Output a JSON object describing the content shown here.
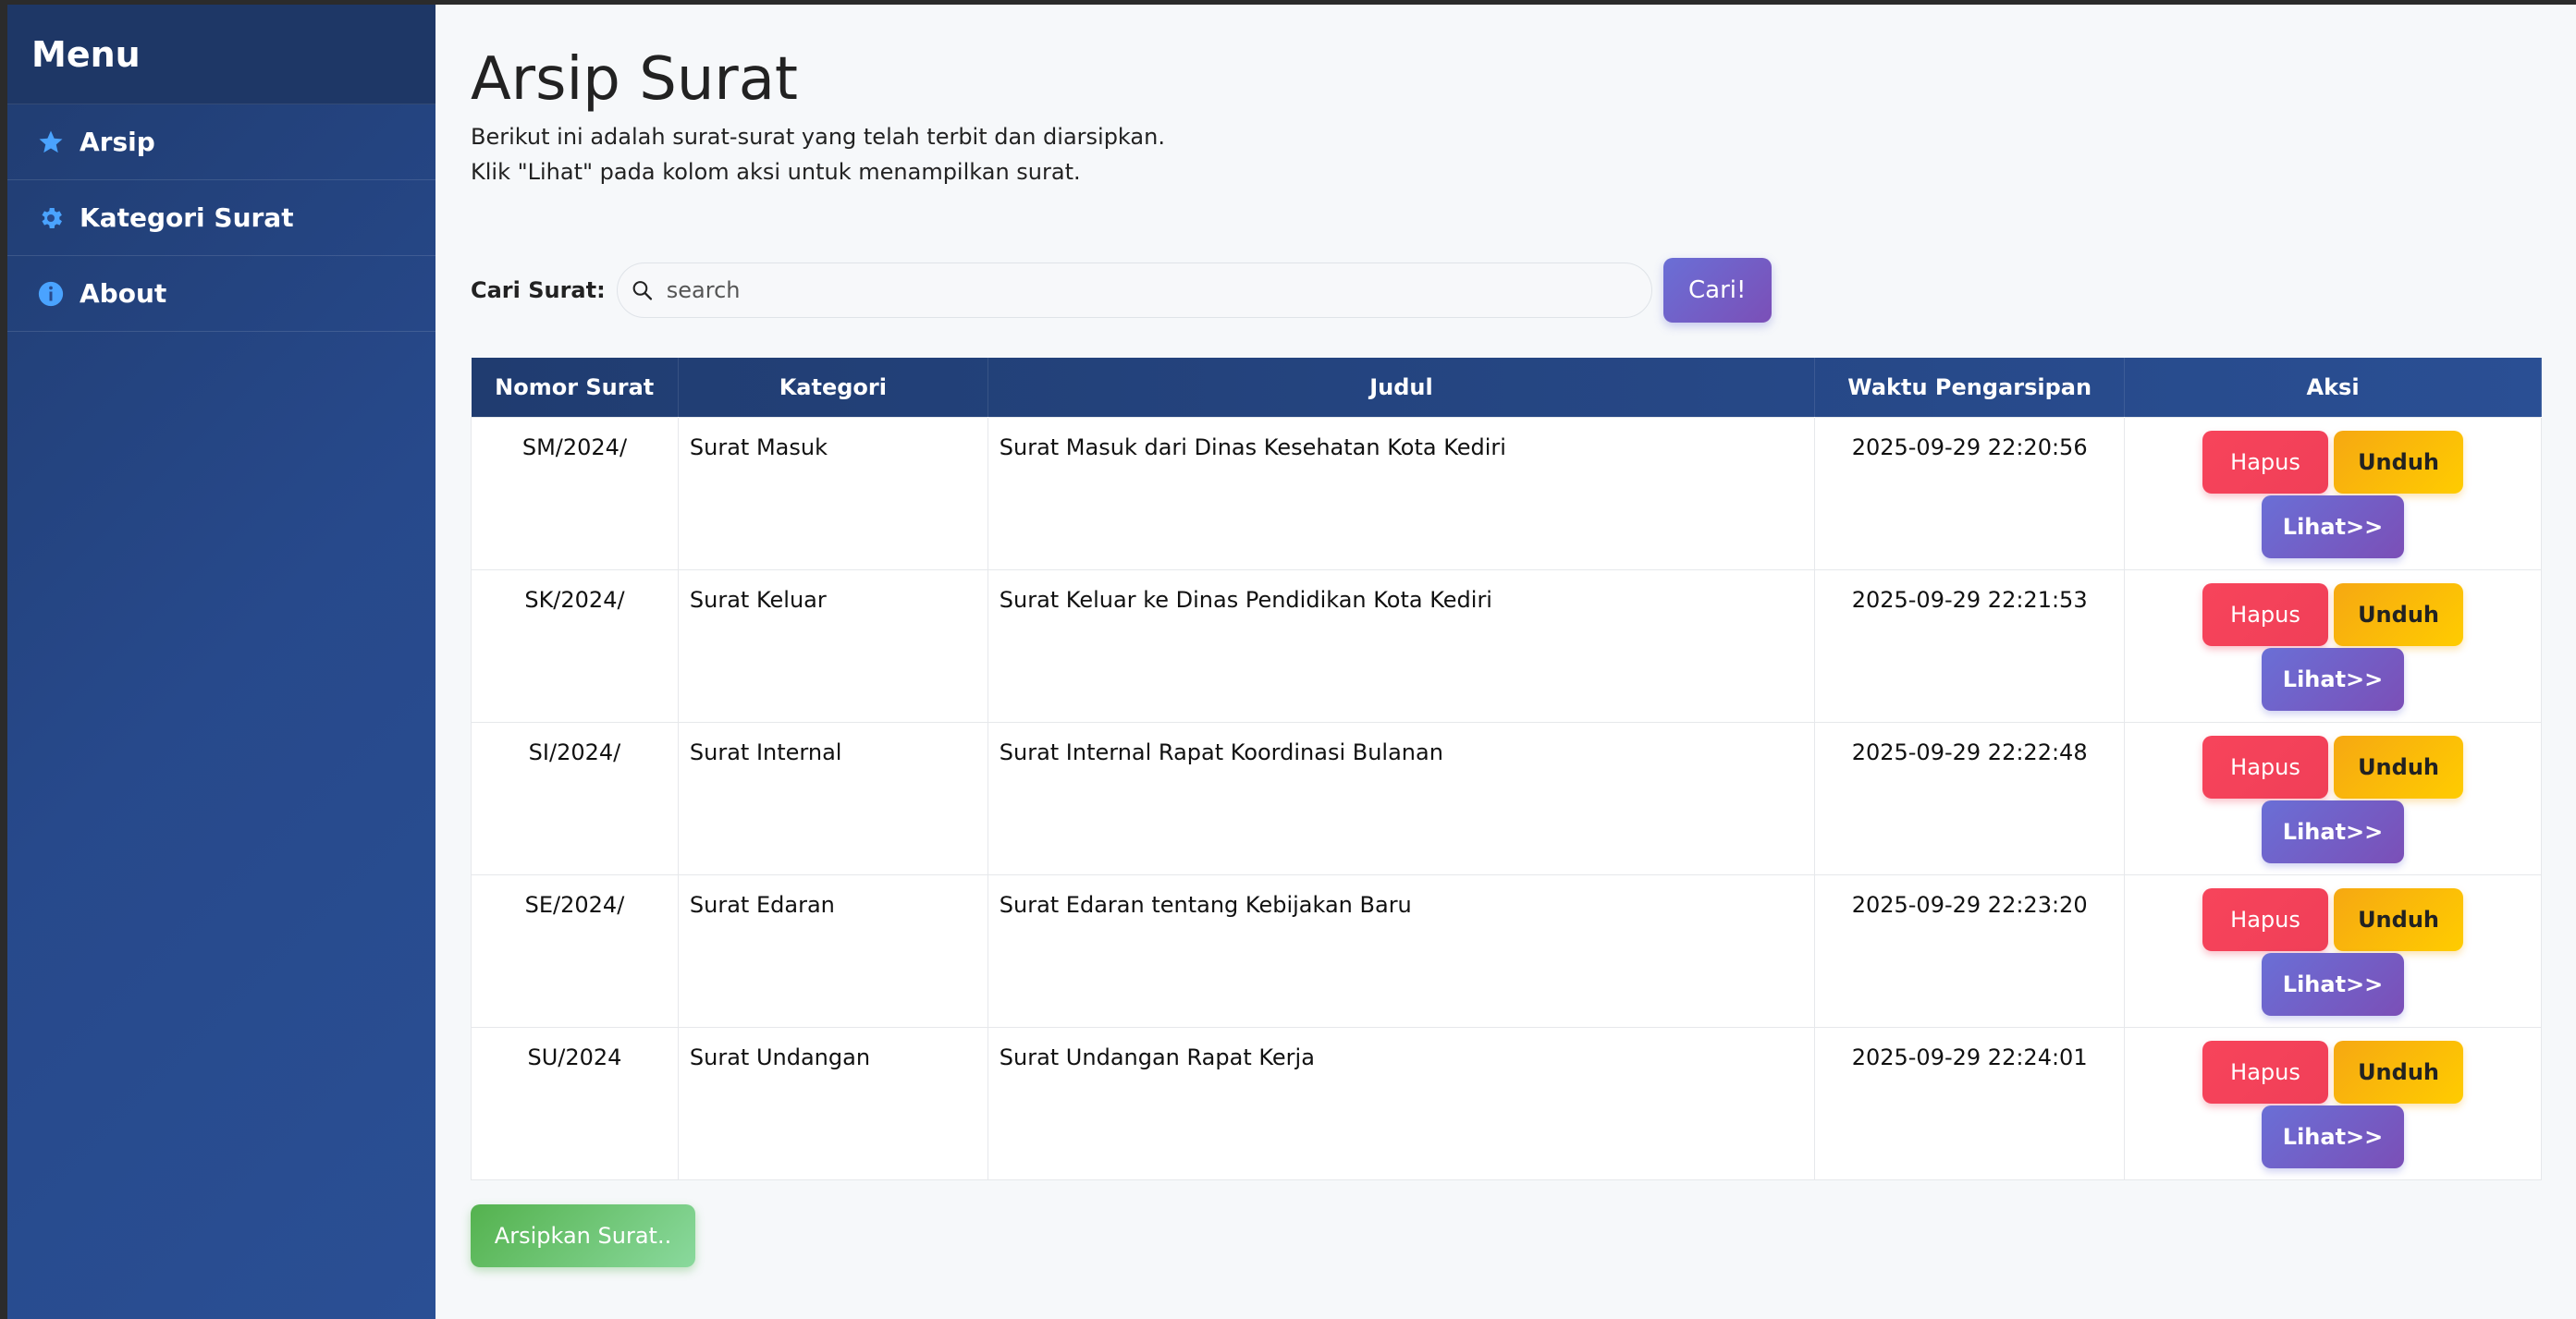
{
  "sidebar": {
    "title": "Menu",
    "items": [
      {
        "label": "Arsip",
        "icon": "star-icon"
      },
      {
        "label": "Kategori Surat",
        "icon": "gear-icon"
      },
      {
        "label": "About",
        "icon": "info-icon"
      }
    ]
  },
  "main": {
    "title": "Arsip Surat",
    "description_line1": "Berikut ini adalah surat-surat yang telah terbit dan diarsipkan.",
    "description_line2": "Klik \"Lihat\" pada kolom aksi untuk menampilkan surat.",
    "search": {
      "label": "Cari Surat:",
      "placeholder": "search",
      "button_label": "Cari!"
    },
    "table": {
      "headers": [
        "Nomor Surat",
        "Kategori",
        "Judul",
        "Waktu Pengarsipan",
        "Aksi"
      ],
      "rows": [
        {
          "nomor": "SM/2024/",
          "kategori": "Surat Masuk",
          "judul": "Surat Masuk dari Dinas Kesehatan Kota Kediri",
          "waktu": "2025-09-29 22:20:56"
        },
        {
          "nomor": "SK/2024/",
          "kategori": "Surat Keluar",
          "judul": "Surat Keluar ke Dinas Pendidikan Kota Kediri",
          "waktu": "2025-09-29 22:21:53"
        },
        {
          "nomor": "SI/2024/",
          "kategori": "Surat Internal",
          "judul": "Surat Internal Rapat Koordinasi Bulanan",
          "waktu": "2025-09-29 22:22:48"
        },
        {
          "nomor": "SE/2024/",
          "kategori": "Surat Edaran",
          "judul": "Surat Edaran tentang Kebijakan Baru",
          "waktu": "2025-09-29 22:23:20"
        },
        {
          "nomor": "SU/2024",
          "kategori": "Surat Undangan",
          "judul": "Surat Undangan Rapat Kerja",
          "waktu": "2025-09-29 22:24:01"
        }
      ],
      "actions": {
        "hapus": "Hapus",
        "unduh": "Unduh",
        "lihat": "Lihat>>"
      }
    },
    "archive_button_label": "Arsipkan Surat.."
  },
  "colors": {
    "sidebar": "#27498b",
    "table_header": "#203c70",
    "hapus": "#f03f58",
    "unduh": "#ffc107",
    "lihat": "#6a6fd6",
    "arsip": "#54b24e"
  }
}
